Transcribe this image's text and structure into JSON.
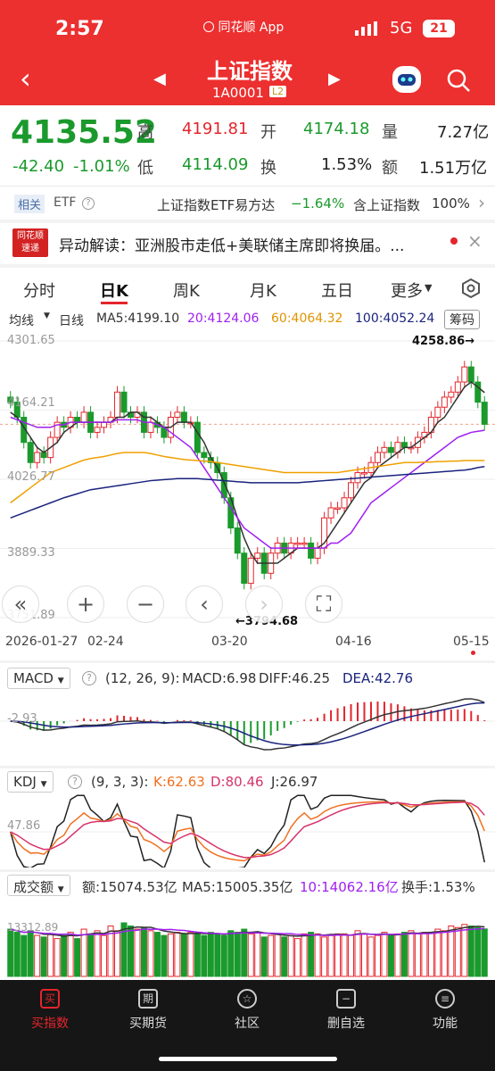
{
  "status": {
    "time": "2:57",
    "app": "同花顺 App",
    "network": "5G",
    "battery": "21"
  },
  "header": {
    "title": "上证指数",
    "code": "1A0001",
    "level": "L2"
  },
  "quote": {
    "price": "4135.52",
    "change": "-42.40",
    "pct": "-1.01%",
    "high_label": "高",
    "high": "4191.81",
    "open_label": "开",
    "open": "4174.18",
    "vol_label": "量",
    "vol": "7.27亿",
    "low_label": "低",
    "low": "4114.09",
    "turn_label": "换",
    "turn": "1.53%",
    "amt_label": "额",
    "amt": "1.51万亿"
  },
  "related": {
    "tag": "相关",
    "etf": "ETF",
    "etf_name": "上证指数ETF易方达",
    "etf_pct": "−1.64%",
    "contain": "含上证指数",
    "contain_pct": "100%"
  },
  "news": {
    "logo1": "同花顺",
    "logo2": "速递",
    "text": "异动解读：亚洲股市走低+美联储主席即将换届。..."
  },
  "tabs": [
    "分时",
    "日K",
    "周K",
    "月K",
    "五日",
    "更多"
  ],
  "ma_bar": {
    "mode": "均线",
    "period": "日线",
    "ma5": "MA5:4199.10",
    "ma20": "20:4124.06",
    "ma60": "60:4064.32",
    "ma100": "100:4052.24",
    "chip": "筹码"
  },
  "yaxis": [
    "4301.65",
    "4164.21",
    "4026.77",
    "3889.33",
    "3751.89"
  ],
  "annotations": {
    "high": "4258.86→",
    "low": "←3794.68"
  },
  "xaxis": [
    "2026-01-27",
    "02-24",
    "03-20",
    "04-16",
    "05-15"
  ],
  "macd": {
    "name": "MACD",
    "params": "(12, 26, 9):",
    "macd": "MACD:6.98",
    "diff": "DIFF:46.25",
    "dea": "DEA:42.76",
    "axis": "-2.93"
  },
  "kdj": {
    "name": "KDJ",
    "params": "(9, 3, 3):",
    "k": "K:62.63",
    "d": "D:80.46",
    "j": "J:26.97",
    "axis": "47.86"
  },
  "volume": {
    "name": "成交额",
    "amt": "额:15074.53亿",
    "ma5": "MA5:15005.35亿",
    "ma10": "10:14062.16亿",
    "turn": "换手:1.53%",
    "axis": "13312.89"
  },
  "bottom_nav": [
    "买指数",
    "买期货",
    "社区",
    "删自选",
    "功能"
  ],
  "colors": {
    "up": "#e4252c",
    "down": "#1a9a2c",
    "header": "#ec2f2f",
    "ma5": "#333333",
    "ma20": "#a020f0",
    "ma60": "#f0a000",
    "ma100": "#1a237e"
  },
  "chart_data": {
    "type": "candlestick",
    "closes": [
      4180,
      4150,
      4100,
      4060,
      4080,
      4070,
      4110,
      4140,
      4130,
      4150,
      4140,
      4160,
      4120,
      4130,
      4140,
      4150,
      4200,
      4160,
      4150,
      4160,
      4120,
      4140,
      4130,
      4110,
      4150,
      4160,
      4140,
      4140,
      4080,
      4070,
      4060,
      4040,
      3990,
      3930,
      3880,
      3820,
      3870,
      3880,
      3840,
      3880,
      3900,
      3880,
      3900,
      3900,
      3900,
      3870,
      3890,
      3950,
      3970,
      3970,
      3990,
      4020,
      4040,
      4040,
      4060,
      4080,
      4090,
      4080,
      4100,
      4090,
      4090,
      4110,
      4120,
      4150,
      4170,
      4190,
      4200,
      4220,
      4250,
      4220,
      4180,
      4136
    ],
    "ma5": [
      4160,
      4150,
      4130,
      4110,
      4090,
      4080,
      4090,
      4100,
      4120,
      4130,
      4140,
      4140,
      4140,
      4140,
      4140,
      4140,
      4150,
      4150,
      4160,
      4160,
      4150,
      4150,
      4140,
      4130,
      4130,
      4140,
      4140,
      4140,
      4120,
      4100,
      4070,
      4050,
      4020,
      3990,
      3950,
      3910,
      3880,
      3860,
      3860,
      3860,
      3860,
      3870,
      3880,
      3890,
      3890,
      3890,
      3890,
      3900,
      3920,
      3940,
      3960,
      3980,
      4000,
      4020,
      4030,
      4050,
      4060,
      4070,
      4080,
      4090,
      4090,
      4100,
      4110,
      4120,
      4140,
      4150,
      4170,
      4190,
      4210,
      4220,
      4210,
      4199
    ],
    "ma20": [
      4150,
      4145,
      4140,
      4135,
      4130,
      4130,
      4130,
      4135,
      4135,
      4140,
      4140,
      4140,
      4140,
      4140,
      4140,
      4140,
      4145,
      4145,
      4145,
      4145,
      4140,
      4140,
      4135,
      4130,
      4120,
      4110,
      4100,
      4090,
      4070,
      4050,
      4030,
      4010,
      3990,
      3970,
      3950,
      3930,
      3920,
      3910,
      3900,
      3890,
      3890,
      3890,
      3890,
      3890,
      3890,
      3890,
      3890,
      3890,
      3900,
      3900,
      3910,
      3920,
      3940,
      3960,
      3980,
      3990,
      4000,
      4010,
      4020,
      4030,
      4040,
      4050,
      4060,
      4070,
      4080,
      4090,
      4100,
      4110,
      4115,
      4120,
      4122,
      4124
    ],
    "ma60": [
      3980,
      3990,
      4000,
      4010,
      4020,
      4030,
      4040,
      4045,
      4050,
      4055,
      4060,
      4065,
      4068,
      4070,
      4072,
      4075,
      4078,
      4080,
      4080,
      4080,
      4080,
      4078,
      4075,
      4072,
      4070,
      4068,
      4066,
      4065,
      4064,
      4063,
      4062,
      4060,
      4058,
      4056,
      4054,
      4052,
      4050,
      4048,
      4046,
      4044,
      4042,
      4040,
      4040,
      4040,
      4040,
      4040,
      4040,
      4040,
      4040,
      4040,
      4042,
      4044,
      4046,
      4048,
      4050,
      4052,
      4054,
      4056,
      4058,
      4060,
      4060,
      4060,
      4061,
      4061,
      4062,
      4062,
      4063,
      4063,
      4064,
      4064,
      4064,
      4064
    ],
    "ma100": [
      3950,
      3955,
      3960,
      3965,
      3970,
      3975,
      3980,
      3985,
      3990,
      3994,
      3998,
      4002,
      4006,
      4008,
      4010,
      4012,
      4014,
      4016,
      4018,
      4020,
      4022,
      4024,
      4025,
      4026,
      4027,
      4028,
      4028,
      4028,
      4028,
      4027,
      4026,
      4025,
      4024,
      4023,
      4022,
      4021,
      4020,
      4020,
      4020,
      4020,
      4020,
      4020,
      4020,
      4020,
      4021,
      4022,
      4023,
      4024,
      4025,
      4026,
      4027,
      4028,
      4029,
      4030,
      4031,
      4032,
      4033,
      4034,
      4035,
      4036,
      4037,
      4038,
      4039,
      4040,
      4041,
      4042,
      4043,
      4044,
      4045,
      4047,
      4050,
      4052
    ],
    "ylim": [
      3751.89,
      4301.65
    ],
    "volume": [
      15000,
      14000,
      13000,
      14500,
      13000,
      12500,
      13500,
      12000,
      13000,
      14000,
      12000,
      15000,
      13500,
      14500,
      13000,
      16000,
      14500,
      17000,
      16000,
      15000,
      15500,
      14500,
      14000,
      13000,
      13500,
      14000,
      13500,
      14000,
      13500,
      13000,
      14000,
      13500,
      13000,
      14500,
      14000,
      15000,
      13500,
      14000,
      12500,
      13000,
      13500,
      12500,
      13000,
      12000,
      13500,
      14000,
      13500,
      12500,
      13000,
      13500,
      13500,
      13000,
      14500,
      13500,
      12500,
      13000,
      14000,
      13000,
      13500,
      14000,
      14500,
      13500,
      14000,
      14000,
      15000,
      14500,
      16000,
      15500,
      16500,
      16000,
      15500,
      15074
    ]
  }
}
